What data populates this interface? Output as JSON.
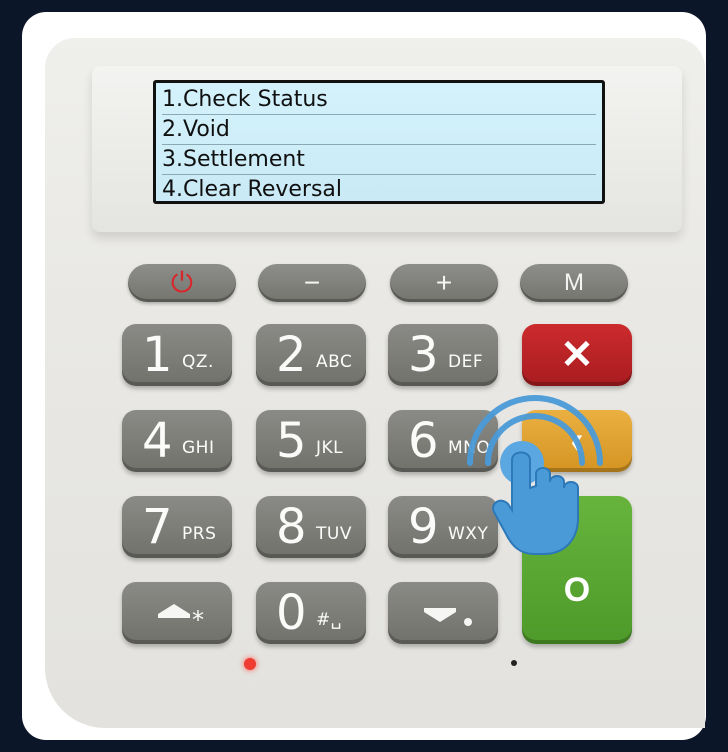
{
  "lcd": {
    "lines": [
      "1.Check Status",
      "2.Void",
      "3.Settlement",
      "4.Clear Reversal"
    ]
  },
  "function_keys": {
    "power": "⏻",
    "minus": "−",
    "plus": "+",
    "menu": "M"
  },
  "keypad": [
    {
      "big": "1",
      "small": "QZ."
    },
    {
      "big": "2",
      "small": "ABC"
    },
    {
      "big": "3",
      "small": "DEF"
    },
    {
      "big": "4",
      "small": "GHI"
    },
    {
      "big": "5",
      "small": "JKL"
    },
    {
      "big": "6",
      "small": "MNO"
    },
    {
      "big": "7",
      "small": "PRS"
    },
    {
      "big": "8",
      "small": "TUV"
    },
    {
      "big": "9",
      "small": "WXY"
    },
    {
      "big": "0",
      "small": "#␣"
    }
  ],
  "special_keys": {
    "cancel": "✕",
    "clear": "‹",
    "enter": "O",
    "up_star": "*"
  },
  "colors": {
    "cancel": "#c02427",
    "clear": "#e3a432",
    "enter": "#5aa833",
    "tap_icon": "#4a9ad8"
  },
  "icons": {
    "tap": "tap-touch-icon"
  }
}
